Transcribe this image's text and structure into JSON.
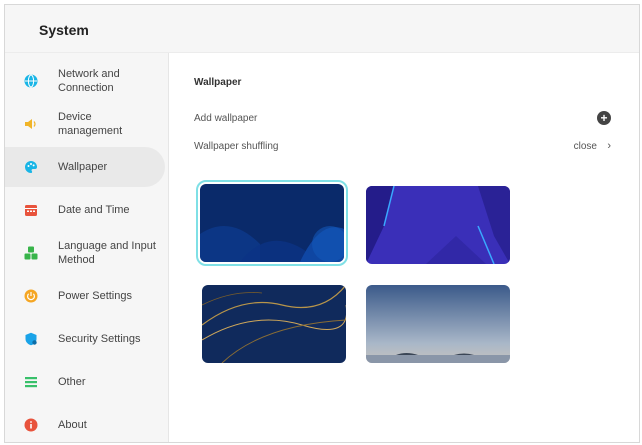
{
  "header": {
    "title": "System"
  },
  "sidebar": {
    "items": [
      {
        "label": "Network and\nConnection",
        "icon": "globe-icon",
        "color": "#19b5e6"
      },
      {
        "label": "Device\nmanagement",
        "icon": "speaker-icon",
        "color": "#f0b428"
      },
      {
        "label": "Wallpaper",
        "icon": "palette-icon",
        "color": "#19b5e6",
        "active": true
      },
      {
        "label": "Date and Time",
        "icon": "calendar-icon",
        "color": "#e8533c"
      },
      {
        "label": "Language and Input\nMethod",
        "icon": "language-icon",
        "color": "#38b44a"
      },
      {
        "label": "Power Settings",
        "icon": "power-icon",
        "color": "#f5a623"
      },
      {
        "label": "Security Settings",
        "icon": "shield-icon",
        "color": "#1aa3e8"
      },
      {
        "label": "Other",
        "icon": "list-icon",
        "color": "#38c06a"
      },
      {
        "label": "About",
        "icon": "info-icon",
        "color": "#e8533c"
      }
    ]
  },
  "main": {
    "section_title": "Wallpaper",
    "add_label": "Add wallpaper",
    "shuffle_label": "Wallpaper shuffling",
    "shuffle_value": "close",
    "accent_color": "#7fe0e6",
    "wallpapers": [
      {
        "name": "dark-blue-abstract",
        "selected": true
      },
      {
        "name": "indigo-angled"
      },
      {
        "name": "gold-lines-navy"
      },
      {
        "name": "dusk-lake"
      }
    ]
  }
}
